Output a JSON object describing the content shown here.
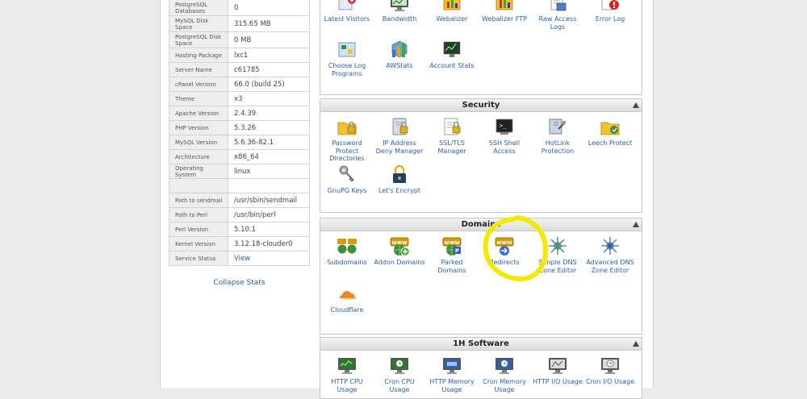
{
  "stats": {
    "rows": [
      {
        "label": "PostgreSQL Databases",
        "value": "0"
      },
      {
        "label": "MySQL Disk Space",
        "value": "315.65 MB"
      },
      {
        "label": "PostgreSQL Disk Space",
        "value": "0 MB"
      },
      {
        "label": "Hosting Package",
        "value": "lxc1"
      },
      {
        "label": "Server Name",
        "value": "c61785"
      },
      {
        "label": "cPanel Version",
        "value": "66.0 (build 25)"
      },
      {
        "label": "Theme",
        "value": "x3"
      },
      {
        "label": "Apache Version",
        "value": "2.4.39"
      },
      {
        "label": "PHP Version",
        "value": "5.3.26"
      },
      {
        "label": "MySQL Version",
        "value": "5.6.36-82.1"
      },
      {
        "label": "Architecture",
        "value": "x86_64"
      },
      {
        "label": "Operating System",
        "value": "linux"
      },
      {
        "label": "",
        "value": ""
      },
      {
        "label": "Path to sendmail",
        "value": "/usr/sbin/sendmail"
      },
      {
        "label": "Path to Perl",
        "value": "/usr/bin/perl"
      },
      {
        "label": "Perl Version",
        "value": "5.10.1"
      },
      {
        "label": "Kernel Version",
        "value": "3.12.18-clouder0"
      },
      {
        "label": "Service Status",
        "value": "View"
      }
    ],
    "collapse_label": "Collapse Stats"
  },
  "logs": {
    "items": [
      {
        "label": "Latest Visitors",
        "icon": "latest-visitors-icon"
      },
      {
        "label": "Bandwidth",
        "icon": "bandwidth-icon"
      },
      {
        "label": "Webalizer",
        "icon": "webalizer-icon"
      },
      {
        "label": "Webalizer FTP",
        "icon": "webalizer-ftp-icon"
      },
      {
        "label": "Raw Access Logs",
        "icon": "raw-access-logs-icon"
      },
      {
        "label": "Error Log",
        "icon": "error-log-icon"
      },
      {
        "label": "Choose Log Programs",
        "icon": "choose-log-programs-icon"
      },
      {
        "label": "AWStats",
        "icon": "awstats-icon"
      },
      {
        "label": "Account Stats",
        "icon": "account-stats-icon"
      }
    ]
  },
  "security": {
    "title": "Security",
    "items": [
      {
        "label": "Password Protect Directories",
        "icon": "folder-lock-icon"
      },
      {
        "label": "IP Address Deny Manager",
        "icon": "ip-deny-icon"
      },
      {
        "label": "SSL/TLS Manager",
        "icon": "ssl-certificate-icon"
      },
      {
        "label": "SSH Shell Access",
        "icon": "terminal-icon"
      },
      {
        "label": "HotLink Protection",
        "icon": "hotlink-icon"
      },
      {
        "label": "Leech Protect",
        "icon": "leech-protect-icon"
      },
      {
        "label": "GnuPG Keys",
        "icon": "keys-icon"
      },
      {
        "label": "Let's Encrypt",
        "icon": "lets-encrypt-icon"
      }
    ]
  },
  "domains": {
    "title": "Domains",
    "items": [
      {
        "label": "Subdomains",
        "icon": "subdomains-icon"
      },
      {
        "label": "Addon Domains",
        "icon": "addon-domains-icon"
      },
      {
        "label": "Parked Domains",
        "icon": "parked-domains-icon"
      },
      {
        "label": "Redirects",
        "icon": "redirects-icon"
      },
      {
        "label": "Simple DNS Zone Editor",
        "icon": "dns-zone-editor-icon"
      },
      {
        "label": "Advanced DNS Zone Editor",
        "icon": "advanced-dns-zone-editor-icon"
      },
      {
        "label": "Cloudflare",
        "icon": "cloudflare-icon"
      }
    ]
  },
  "software": {
    "title": "1H Software",
    "items": [
      {
        "label": "HTTP CPU Usage",
        "icon": "http-cpu-usage-icon"
      },
      {
        "label": "Cron CPU Usage",
        "icon": "cron-cpu-usage-icon"
      },
      {
        "label": "HTTP Memory Usage",
        "icon": "http-memory-usage-icon"
      },
      {
        "label": "Cron Memory Usage",
        "icon": "cron-memory-usage-icon"
      },
      {
        "label": "HTTP I/O Usage",
        "icon": "http-io-usage-icon"
      },
      {
        "label": "Cron I/O Usage",
        "icon": "cron-io-usage-icon"
      }
    ]
  },
  "colors": {
    "link": "#2b5ea8",
    "highlight": "#f2ea00",
    "www_badge": "#e0a400"
  }
}
